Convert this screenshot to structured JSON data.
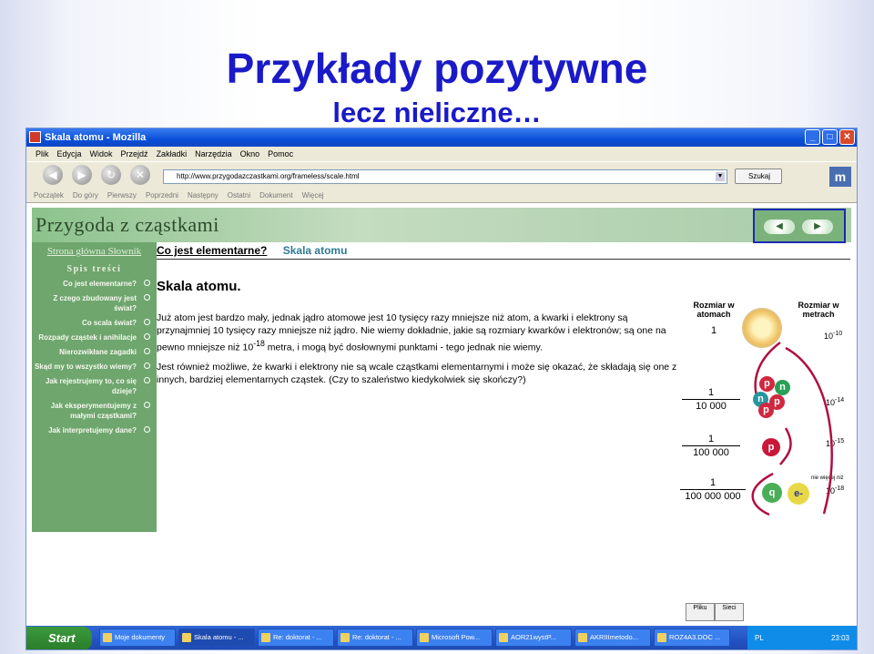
{
  "slide": {
    "title": "Przykłady pozytywne",
    "subtitle": "lecz nieliczne…"
  },
  "window": {
    "title": "Skala atomu - Mozilla",
    "buttons": [
      "_",
      "□",
      "✕"
    ]
  },
  "menu": [
    "Plik",
    "Edycja",
    "Widok",
    "Przejdź",
    "Zakładki",
    "Narzędzia",
    "Okno",
    "Pomoc"
  ],
  "navigation": {
    "url": "http://www.przygodazczastkami.org/frameless/scale.html",
    "search_label": "Szukaj"
  },
  "personal_toolbar": [
    "Początek",
    "Do góry",
    "Pierwszy",
    "Poprzedni",
    "Następny",
    "Ostatni",
    "Dokument",
    "Więcej"
  ],
  "site": {
    "banner_title": "Przygoda z cząstkami",
    "sidebar_links": "Strona główna Słownik",
    "sidebar_heading": "Spis treści",
    "sidebar_items": [
      "Co jest elementarne?",
      "Z czego zbudowany jest świat?",
      "Co scala świat?",
      "Rozpady cząstek i anihilacje",
      "Nierozwikłane zagadki",
      "Skąd my to wszystko wiemy?",
      "Jak rejestrujemy to, co się dzieje?",
      "Jak eksperymentujemy z małymi cząstkami?",
      "Jak interpretujemy dane?"
    ],
    "breadcrumb_current": "Co jest elementarne?",
    "breadcrumb_page": "Skala atomu",
    "page_title": "Skala atomu.",
    "paragraph1_a": "Już atom jest bardzo mały, jednak jądro atomowe jest 10 tysięcy razy mniejsze niż atom, a kwarki i elektrony są przynajmniej 10 tysięcy razy mniejsze niż jądro. Nie wiemy dokładnie, jakie są rozmiary kwarków i elektronów; są one na pewno mniejsze niż 10",
    "paragraph1_exp": "-18",
    "paragraph1_b": " metra, i mogą być dosłownymi punktami - tego jednak nie wiemy.",
    "paragraph2": "Jest również możliwe, że kwarki i elektrony nie są wcale cząstkami elementarnymi i może się okazać, że składają się one z innych, bardziej elementarnych cząstek. (Czy to szaleństwo kiedykolwiek się skończy?)"
  },
  "scale_figure": {
    "col1_label": "Rozmiar w atomach",
    "col2_label": "Rozmiar w metrach",
    "atoms": [
      "1",
      "1",
      "10 000",
      "1",
      "100 000",
      "1",
      "100 000 000"
    ],
    "meters_base": "10",
    "meters_exp": [
      "-10",
      "-14",
      "-15",
      "-18"
    ],
    "electron_note": "nie więcej niż",
    "particles": [
      "p",
      "n",
      "n",
      "p",
      "p",
      "p",
      "q",
      "e-"
    ]
  },
  "statusbar": [
    "Pliku",
    "Sieci"
  ],
  "taskbar": {
    "start": "Start",
    "tasks": [
      "Moje dokumenty",
      "Skala atomu - ...",
      "Re: doktorat - ...",
      "Re: doktorat - ...",
      "Microsoft Pow...",
      "AOR21wystP...",
      "AKRIIImetodo...",
      "ROZ4A3.DOC ..."
    ],
    "lang": "PL",
    "clock": "23:03"
  },
  "colors": {
    "slide_title": "#1a1ac8",
    "sidebar": "#6ea66e",
    "taskbar": "#2456c7",
    "link_teal": "#2f7a96"
  }
}
